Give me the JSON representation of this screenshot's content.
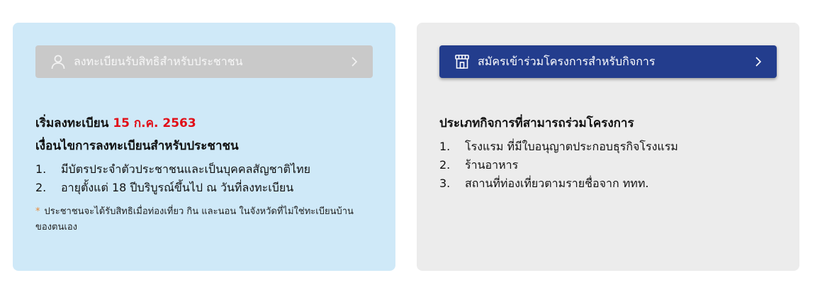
{
  "citizen": {
    "button_label": "ลงทะเบียนรับสิทธิสำหรับประชาชน",
    "start_prefix": "เริ่มลงทะเบียน",
    "start_date": "15 ก.ค. 2563",
    "conditions_title": "เงื่อนไขการลงทะเบียนสำหรับประชาชน",
    "conditions": [
      {
        "num": "1.",
        "text": "มีบัตรประจำตัวประชาชนและเป็นบุคคลสัญชาติไทย"
      },
      {
        "num": "2.",
        "text": "อายุตั้งแต่ 18 ปีบริบูรณ์ขึ้นไป ณ วันที่ลงทะเบียน"
      }
    ],
    "note_mark": "*",
    "note": "ประชาชนจะได้รับสิทธิเมื่อท่องเที่ยว กิน และนอน ในจังหวัดที่ไม่ใช่ทะเบียนบ้านของตนเอง"
  },
  "business": {
    "button_label": "สมัครเข้าร่วมโครงการสำหรับกิจการ",
    "types_title": "ประเภทกิจการที่สามารถร่วมโครงการ",
    "types": [
      {
        "num": "1.",
        "text": "โรงแรม ที่มีใบอนุญาตประกอบธุรกิจโรงแรม"
      },
      {
        "num": "2.",
        "text": "ร้านอาหาร"
      },
      {
        "num": "3.",
        "text": "สถานที่ท่องเที่ยวตามรายชื่อจาก ททท."
      }
    ]
  },
  "icons": {
    "citizen_button": "user-icon",
    "business_button": "shop-icon",
    "chevron": "chevron-right-icon"
  },
  "colors": {
    "citizen_card_bg": "#cfe9f8",
    "business_card_bg": "#ececec",
    "disabled_button_bg": "#c9c9c9",
    "primary_button_bg": "#233d8d",
    "date_highlight": "#e10d17",
    "note_mark": "#e88b3a"
  }
}
